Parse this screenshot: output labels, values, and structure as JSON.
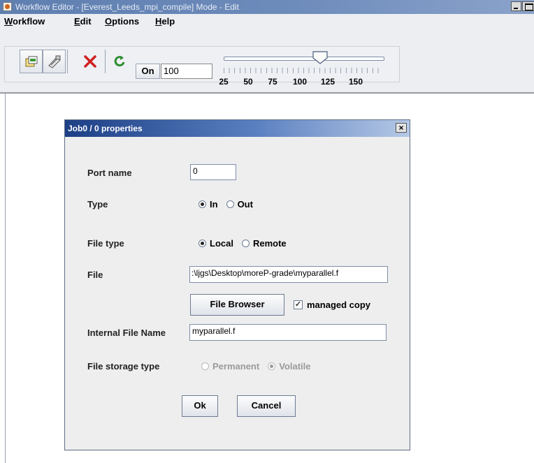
{
  "window": {
    "title": "Workflow Editor - [Everest_Leeds_mpi_compile] Mode - Edit"
  },
  "menubar": {
    "items": [
      "Workflow",
      "Edit",
      "Options",
      "Help"
    ]
  },
  "toolbar": {
    "on_label": "On",
    "zoom_value": "100",
    "zoom_fraction": 0.6,
    "slider_labels": [
      "25",
      "50",
      "75",
      "100",
      "125",
      "150"
    ],
    "icons": [
      "open-icon",
      "link-icon",
      "delete-icon",
      "refresh-icon"
    ]
  },
  "dialog": {
    "title": "Job0 / 0 properties",
    "close": "×",
    "port_name_label": "Port name",
    "port_name_value": "0",
    "type_label": "Type",
    "type_options": [
      "In",
      "Out"
    ],
    "type_selected": "In",
    "file_type_label": "File type",
    "file_type_options": [
      "Local",
      "Remote"
    ],
    "file_type_selected": "Local",
    "file_label": "File",
    "file_value": ":\\ljgs\\Desktop\\moreP-grade\\myparallel.f",
    "file_browser_button": "File Browser",
    "managed_copy_label": "managed copy",
    "managed_copy_checked": true,
    "internal_file_name_label": "Internal File Name",
    "internal_file_name_value": "myparallel.f",
    "file_storage_type_label": "File storage type",
    "storage_options": [
      "Permanent",
      "Volatile"
    ],
    "storage_selected": "Volatile",
    "ok_button": "Ok",
    "cancel_button": "Cancel"
  }
}
